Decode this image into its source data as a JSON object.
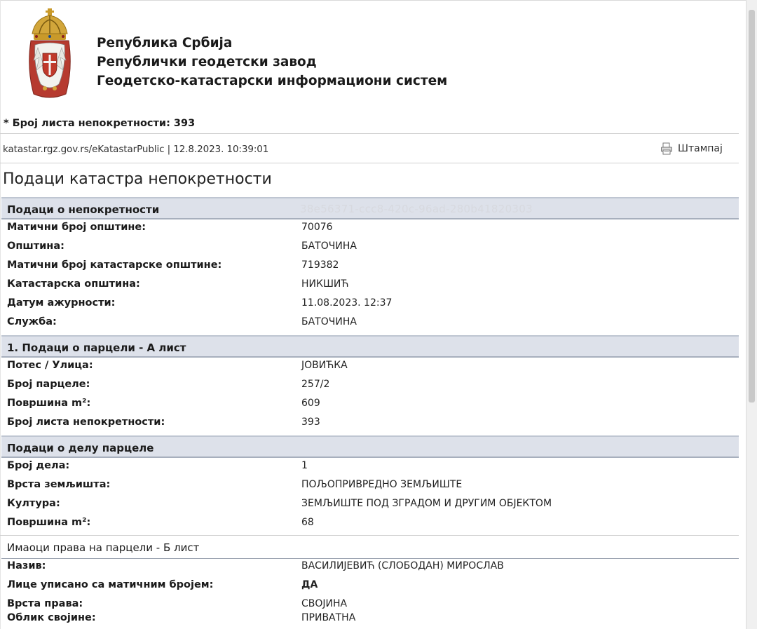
{
  "header": {
    "line1": "Република Србија",
    "line2": "Републички геодетски завод",
    "line3": "Геодетско-катастарски информациони систем"
  },
  "sheet_number_line": "* Број листа непокретности: 393",
  "source_line": "katastar.rgz.gov.rs/eKatastarPublic | 12.8.2023. 10:39:01",
  "print_label": "Штампај",
  "page_title": "Подаци катастра непокретности",
  "property_section": {
    "title": "Подаци о непокретности",
    "guid": "38e56371-ccc8-420c-96ad-280b41820303",
    "rows": [
      {
        "label": "Матични број општине:",
        "value": "70076"
      },
      {
        "label": "Општина:",
        "value": "БАТОЧИНА"
      },
      {
        "label": "Матични број катастарске општине:",
        "value": "719382"
      },
      {
        "label": "Катастарска општина:",
        "value": "НИКШИЋ"
      },
      {
        "label": "Датум ажурности:",
        "value": "11.08.2023. 12:37"
      },
      {
        "label": "Служба:",
        "value": "БАТОЧИНА"
      }
    ]
  },
  "parcel_section": {
    "title": "1. Подаци о парцели - А лист",
    "rows": [
      {
        "label": "Потес / Улица:",
        "value": "ЈОВИЋКА"
      },
      {
        "label": "Број парцеле:",
        "value": "257/2"
      },
      {
        "label": "Површина m²:",
        "value": "609"
      },
      {
        "label": "Број листа непокретности:",
        "value": "393"
      }
    ]
  },
  "parcel_part_section": {
    "title": "Подаци о делу парцеле",
    "rows": [
      {
        "label": "Број дела:",
        "value": "1"
      },
      {
        "label": "Врста земљишта:",
        "value": "ПОЉОПРИВРЕДНО ЗЕМЉИШТЕ"
      },
      {
        "label": "Култура:",
        "value": "ЗЕМЉИШТЕ ПОД ЗГРАДОМ И ДРУГИМ ОБЈЕКТОМ"
      },
      {
        "label": "Површина m²:",
        "value": "68"
      }
    ]
  },
  "owners_section": {
    "title": "Имаоци права на парцели - Б лист",
    "rows": [
      {
        "label": "Назив:",
        "value": "ВАСИЛИЈЕВИЋ (СЛОБОДАН) МИРОСЛАВ"
      },
      {
        "label": "Лице уписано са матичним бројем:",
        "value": "ДА"
      },
      {
        "label": "Врста права:",
        "value": "СВОЈИНА"
      },
      {
        "label": "Облик својине:",
        "value": "ПРИВАТНА"
      }
    ]
  }
}
